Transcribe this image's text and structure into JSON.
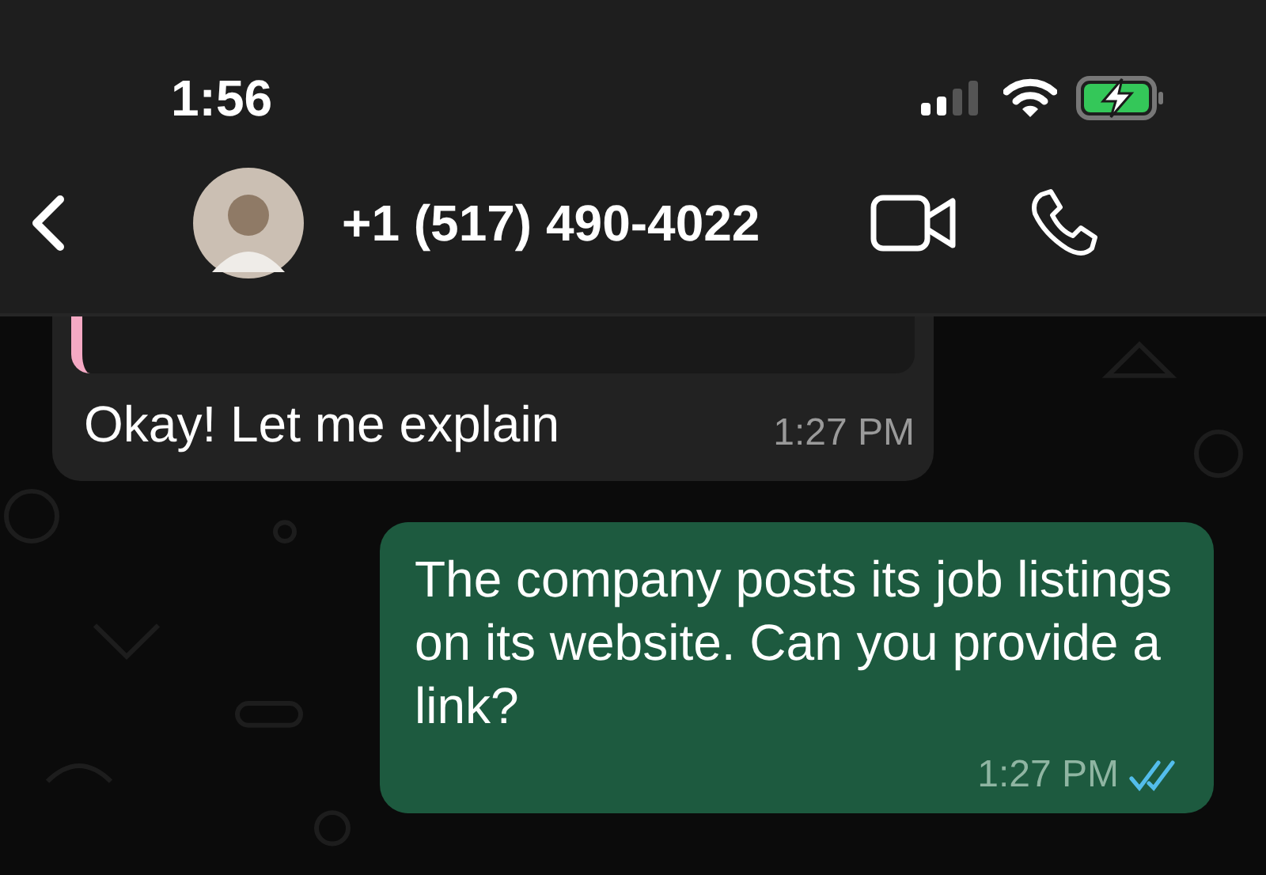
{
  "status_bar": {
    "time": "1:56",
    "charging": true
  },
  "header": {
    "contact": "+1 (517) 490-4022"
  },
  "messages": [
    {
      "kind": "incoming",
      "reply": true,
      "text": "Okay! Let me explain",
      "time": "1:27 PM"
    },
    {
      "kind": "outgoing",
      "reply": false,
      "text": "The company posts its job listings on its website. Can you provide a link?",
      "time": "1:27 PM",
      "read": true
    }
  ]
}
